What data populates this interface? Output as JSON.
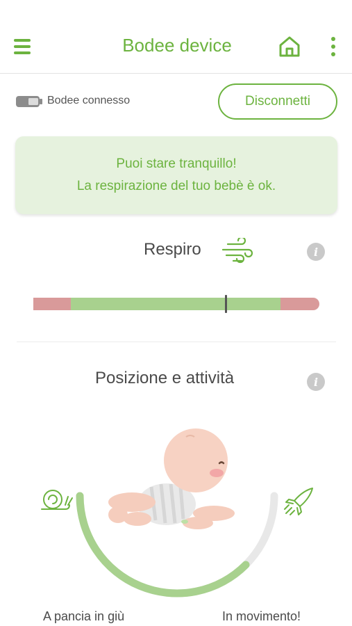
{
  "header": {
    "title": "Bodee device",
    "menu_icon": "hamburger-menu-icon",
    "home_icon": "home-icon",
    "more_icon": "kebab-menu-icon"
  },
  "status": {
    "connection_text": "Bodee connesso",
    "battery_icon": "battery-icon",
    "disconnect_label": "Disconnetti"
  },
  "alert": {
    "line1": "Puoi stare tranquillo!",
    "line2": "La respirazione del tuo bebè è ok."
  },
  "breathing": {
    "title": "Respiro",
    "icon": "wind-icon",
    "info_icon": "info-icon",
    "level": 0.67
  },
  "position": {
    "title": "Posizione e attività",
    "info_icon": "info-icon",
    "left_icon": "snail-icon",
    "right_icon": "rocket-icon",
    "activity_level": 0.75,
    "left_label": "A pancia in giù",
    "right_label": "In movimento!"
  },
  "colors": {
    "brand_green": "#6cb33f",
    "light_green": "#a8d18e",
    "alert_bg": "#e6f2de",
    "warning_red": "#d99a9a",
    "gray": "#c9c9c9"
  }
}
